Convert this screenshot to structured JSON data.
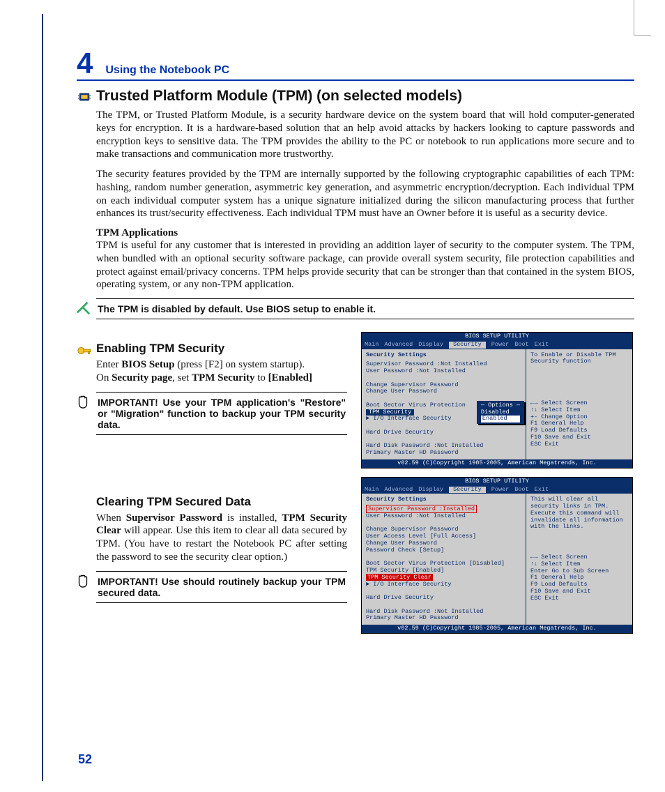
{
  "chapter": {
    "number": "4",
    "title": "Using the Notebook PC"
  },
  "h1": "Trusted Platform Module (TPM) (on selected models)",
  "para1": "The TPM, or Trusted Platform Module, is a security hardware device on the system board that will hold computer-generated keys for encryption. It is a hardware-based solution that an help avoid attacks by hackers looking to capture passwords and encryption keys to sensitive data. The TPM provides the ability to the PC or notebook to run applications more secure and to make transactions and communication more trustworthy.",
  "para2": "The security features provided by the TPM are internally supported by the following cryptographic capabilities of each TPM: hashing, random number generation, asymmetric key generation, and asymmetric encryption/decryption. Each individual TPM on each individual computer system has a unique signature initialized during the silicon manufacturing process that further enhances its trust/security effectiveness. Each individual TPM must have an Owner before it is useful as a security device.",
  "apps_head": "TPM Applications",
  "para3": "TPM is useful for any customer that is interested in providing an addition layer of security to the computer system. The TPM, when bundled with an optional security software package, can provide overall system security, file protection capabilities and protect against email/privacy concerns. TPM helps provide security that can be stronger than that contained in the system BIOS, operating system, or any non-TPM application.",
  "note1": "The TPM is disabled by default. Use BIOS setup to enable it.",
  "h2a": "Enabling TPM Security",
  "enable": {
    "line1_a": "Enter ",
    "line1_b": "BIOS Setup",
    "line1_c": " (press [F2] on system startup).",
    "line2_a": "On ",
    "line2_b": "Security page",
    "line2_c": ", set ",
    "line2_d": "TPM Security",
    "line2_e": " to ",
    "line2_f": "[Enabled]"
  },
  "imp1": "IMPORTANT! Use your TPM application's \"Restore\" or \"Migration\" function to backup your TPM security data.",
  "h2b": "Clearing TPM Secured Data",
  "clear": {
    "a": "When ",
    "b": "Supervisor Password",
    "c": " is installed, ",
    "d": "TPM Security Clear",
    "e": " will appear. Use this item to clear all data secured by TPM. (You have to restart the Notebook PC after setting the password to see the security clear option.)"
  },
  "imp2": "IMPORTANT! Use should routinely backup your TPM secured data.",
  "page_number": "52",
  "bios": {
    "title": "BIOS SETUP UTILITY",
    "tabs": [
      "Main",
      "Advanced",
      "Display",
      "Security",
      "Power",
      "Boot",
      "Exit"
    ],
    "footer": "v02.59 (C)Copyright 1985-2005, American Megatrends, Inc.",
    "screen1": {
      "heading": "Security Settings",
      "lines": [
        "Supervisor Password :Not Installed",
        "User Password       :Not Installed",
        "",
        "Change Supervisor Password",
        "Change User Password",
        "",
        "Boot Sector Virus Protection",
        "",
        "► I/O Interface Security",
        "",
        "Hard Drive Security",
        "",
        "Hard Disk Password  :Not Installed",
        "Primary Master HD Password"
      ],
      "highlight_row": "TPM Security",
      "options_title": "— Options —",
      "options": [
        "Disabled",
        "Enabled"
      ],
      "help_top": "To Enable or Disable TPM Security function",
      "help_keys": [
        "←→   Select Screen",
        "↑↓   Select Item",
        "+-   Change Option",
        "F1   General Help",
        "F9   Load Defaults",
        "F10  Save and Exit",
        "ESC  Exit"
      ]
    },
    "screen2": {
      "heading": "Security Settings",
      "sup_label": "Supervisor Password",
      "sup_value": "Installed",
      "lines_after": [
        "User Password       :Not Installed",
        "",
        "Change Supervisor Password",
        "User Access Level          [Full Access]",
        "Change User Password",
        "Password Check             [Setup]",
        "",
        "Boot Sector Virus Protection  [Disabled]",
        "TPM Security                  [Enabled]"
      ],
      "clear_row": "TPM Security Clear",
      "lines_tail": [
        "► I/O Interface Security",
        "",
        "Hard Drive Security",
        "",
        "Hard Disk Password  :Not Installed",
        "Primary Master HD Password"
      ],
      "help_top": "This will clear all security links in TPM. Execute this command will invalidate all information with the links.",
      "help_keys": [
        "←→   Select Screen",
        "↑↓   Select Item",
        "Enter Go to Sub Screen",
        "F1   General Help",
        "F9   Load Defaults",
        "F10  Save and Exit",
        "ESC  Exit"
      ]
    }
  }
}
